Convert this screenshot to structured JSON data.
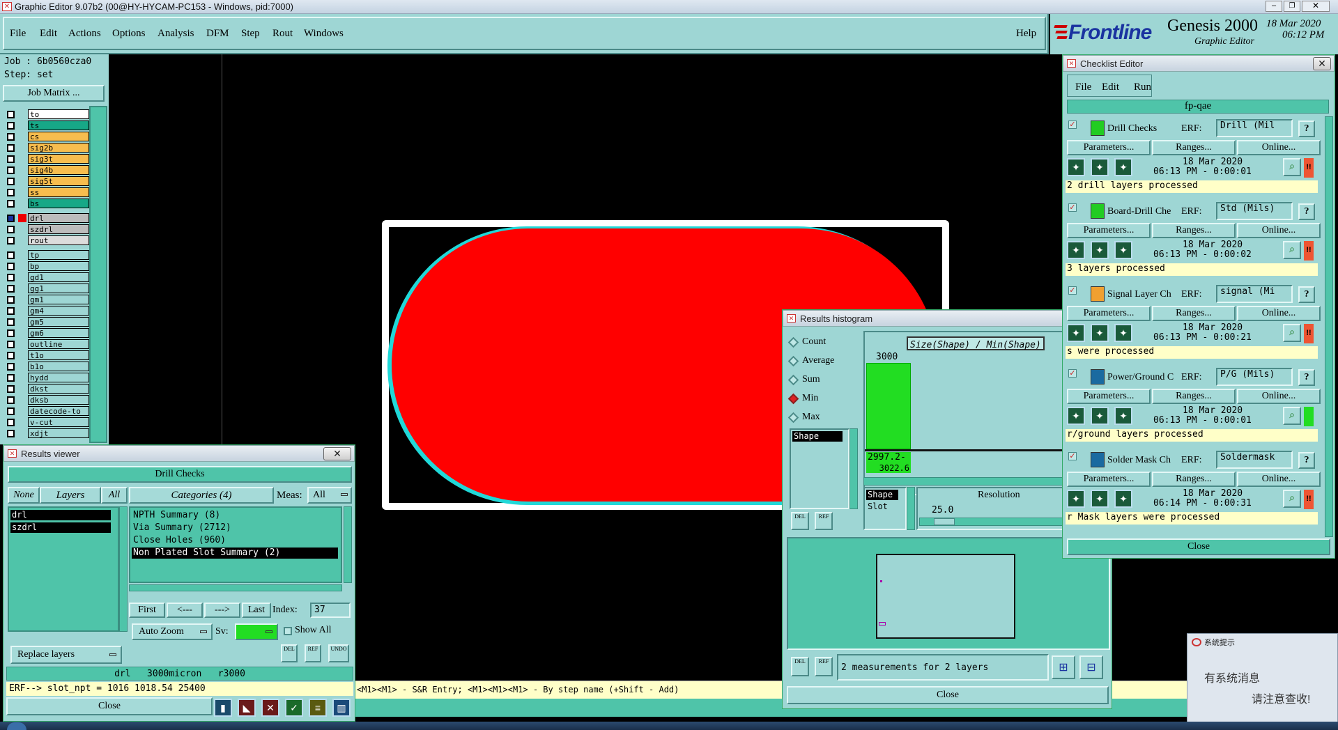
{
  "app": {
    "title": "Graphic Editor 9.07b2 (00@HY-HYCAM-PC153 - Windows, pid:7000)",
    "menu": [
      "File",
      "Edit",
      "Actions",
      "Options",
      "Analysis",
      "DFM",
      "Step",
      "Rout",
      "Windows"
    ],
    "help": "Help",
    "brand": "Frontline",
    "product": "Genesis 2000",
    "product_sub": "Graphic Editor",
    "date": "18 Mar 2020",
    "time": "06:12 PM"
  },
  "job": {
    "job_label": "Job : 6b0560cza0",
    "step_label": "Step: set",
    "job_matrix": "Job Matrix ..."
  },
  "layers": [
    {
      "name": "to",
      "color": "#ffffff"
    },
    {
      "name": "ts",
      "color": "#17a887"
    },
    {
      "name": "cs",
      "color": "#f7bd4e"
    },
    {
      "name": "sig2b",
      "color": "#f7bd4e"
    },
    {
      "name": "sig3t",
      "color": "#f7bd4e"
    },
    {
      "name": "sig4b",
      "color": "#f7bd4e"
    },
    {
      "name": "sig5t",
      "color": "#f7bd4e"
    },
    {
      "name": "ss",
      "color": "#f7bd4e"
    },
    {
      "name": "bs",
      "color": "#17a887"
    },
    {
      "name": "drl",
      "color": "#bcbcbc"
    },
    {
      "name": "szdrl",
      "color": "#bcbcbc"
    },
    {
      "name": "rout",
      "color": "#dcdcdc"
    },
    {
      "name": "tp",
      "color": "#9ed6d4"
    },
    {
      "name": "bp",
      "color": "#9ed6d4"
    },
    {
      "name": "gd1",
      "color": "#9ed6d4"
    },
    {
      "name": "gg1",
      "color": "#9ed6d4"
    },
    {
      "name": "gm1",
      "color": "#9ed6d4"
    },
    {
      "name": "gm4",
      "color": "#9ed6d4"
    },
    {
      "name": "gm5",
      "color": "#9ed6d4"
    },
    {
      "name": "gm6",
      "color": "#9ed6d4"
    },
    {
      "name": "outline",
      "color": "#9ed6d4"
    },
    {
      "name": "t1o",
      "color": "#9ed6d4"
    },
    {
      "name": "b1o",
      "color": "#9ed6d4"
    },
    {
      "name": "hydd",
      "color": "#9ed6d4"
    },
    {
      "name": "dkst",
      "color": "#9ed6d4"
    },
    {
      "name": "dksb",
      "color": "#9ed6d4"
    },
    {
      "name": "datecode-to",
      "color": "#9ed6d4"
    },
    {
      "name": "v-cut",
      "color": "#9ed6d4"
    },
    {
      "name": "xdjt",
      "color": "#9ed6d4"
    }
  ],
  "status_line": "<M1><M1> - S&R Entry; <M1><M1><M1> - By step name (+Shift - Add)",
  "results_viewer": {
    "title": "Results viewer",
    "header": "Drill Checks",
    "none": "None",
    "layers": "Layers",
    "all": "All",
    "categories": "Categories (4)",
    "meas": "Meas:",
    "meas_val": "All",
    "layer_items": [
      "drl",
      "szdrl"
    ],
    "category_items": [
      "NPTH Summary (8)",
      "Via Summary (2712)",
      "Close Holes (960)",
      "Non Plated Slot Summary (2)"
    ],
    "first": "First",
    "prev": "<---",
    "next": "--->",
    "last": "Last",
    "index_label": "Index:",
    "index_val": "37",
    "auto_zoom": "Auto Zoom",
    "sv": "Sv:",
    "show_all": "Show All",
    "replace_layers": "Replace layers",
    "info": "drl   3000micron   r3000",
    "erf": "ERF--> slot_npt = 1016 1018.54 25400",
    "close": "Close",
    "del": "DEL",
    "ref": "REF",
    "undo": "UNDO"
  },
  "histogram": {
    "title": "Results histogram",
    "options": [
      "Count",
      "Average",
      "Sum",
      "Min",
      "Max"
    ],
    "selected": "Min",
    "label": "Size(Shape) / Min(Shape)",
    "bar_value": "3000",
    "range_line1": "2997.2-",
    "range_line2": "3022.6",
    "list_item": "Shape",
    "attr_items": [
      "Shape",
      "Slot"
    ],
    "resolution_label": "Resolution",
    "resolution_val": "25.0",
    "measurements": "2 measurements for 2 layers",
    "close": "Close",
    "del": "DEL",
    "ref": "REF"
  },
  "checklist": {
    "title": "Checklist Editor",
    "menu": [
      "File",
      "Edit",
      "Run"
    ],
    "name": "fp-qae",
    "params": "Parameters...",
    "ranges": "Ranges...",
    "online": "Online...",
    "erf": "ERF:",
    "close": "Close",
    "items": [
      {
        "name": "Drill Checks",
        "erf": "Drill (Mil",
        "date": "18 Mar 2020",
        "time": "06:13 PM - 0:00:01",
        "status": "2 drill layers processed",
        "status_color": "#e53"
      },
      {
        "name": "Board-Drill Che",
        "erf": "Std (Mils)",
        "date": "18 Mar 2020",
        "time": "06:13 PM - 0:00:02",
        "status": "3 layers processed",
        "status_color": "#e53"
      },
      {
        "name": "Signal Layer Ch",
        "erf": "signal (Mi",
        "date": "18 Mar 2020",
        "time": "06:13 PM - 0:00:21",
        "status": "s were processed",
        "status_color": "#e53"
      },
      {
        "name": "Power/Ground C",
        "erf": "P/G (Mils)",
        "date": "18 Mar 2020",
        "time": "06:13 PM - 0:00:01",
        "status": "r/ground layers processed",
        "status_color": "#2d2"
      },
      {
        "name": "Solder Mask Ch",
        "erf": "Soldermask",
        "date": "18 Mar 2020",
        "time": "06:14 PM - 0:00:31",
        "status": "r Mask layers were processed",
        "status_color": "#e53"
      }
    ]
  },
  "notify": {
    "title": "系统提示",
    "line1": "有系统消息",
    "line2": "请注意查收!"
  }
}
